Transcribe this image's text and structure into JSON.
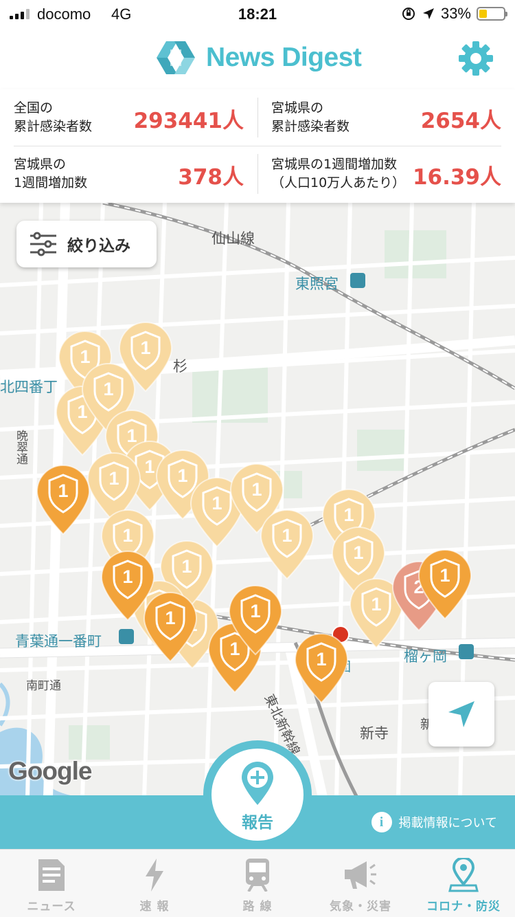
{
  "status_bar": {
    "carrier": "docomo",
    "network": "4G",
    "time": "18:21",
    "battery": "33%",
    "battery_level": 0.33
  },
  "header": {
    "title": "News Digest",
    "settings_icon": "gear-icon",
    "accent_color": "#4bbfcf"
  },
  "stats": [
    {
      "label": "全国の\n累計感染者数",
      "value": "293441人"
    },
    {
      "label": "宮城県の\n累計感染者数",
      "value": "2654人"
    },
    {
      "label": "宮城県の\n1週間増加数",
      "value": "378人"
    },
    {
      "label": "宮城県の1週間増加数\n（人口10万人あたり）",
      "value": "16.39人"
    }
  ],
  "stat_value_color": "#e5514b",
  "map": {
    "filter_label": "絞り込み",
    "attribution": "Google",
    "labels": {
      "senzan_line": "仙山線",
      "toshogu": "東照宮",
      "kitayobancho": "北四番丁",
      "sugi": "杉",
      "banshodori": "晩翠通",
      "aoba_ichibancho": "青葉通一番町",
      "tsutsujigaoka": "榴ヶ岡",
      "minamimachi": "南町通",
      "tohoku_shinkansen": "東北新幹線",
      "shinji": "新寺",
      "shin": "新",
      "de": "団"
    },
    "pins": [
      {
        "count": "1",
        "tone": "light"
      },
      {
        "count": "1",
        "tone": "light"
      },
      {
        "count": "1",
        "tone": "light"
      },
      {
        "count": "1",
        "tone": "light"
      },
      {
        "count": "1",
        "tone": "light"
      },
      {
        "count": "1",
        "tone": "light"
      },
      {
        "count": "1",
        "tone": "light"
      },
      {
        "count": "1",
        "tone": "light"
      },
      {
        "count": "1",
        "tone": "light"
      },
      {
        "count": "1",
        "tone": "light"
      },
      {
        "count": "1",
        "tone": "light"
      },
      {
        "count": "1",
        "tone": "light"
      },
      {
        "count": "1",
        "tone": "light"
      },
      {
        "count": "1",
        "tone": "light"
      },
      {
        "count": "1",
        "tone": "light"
      },
      {
        "count": "1",
        "tone": "light"
      },
      {
        "count": "1",
        "tone": "light"
      },
      {
        "count": "1",
        "tone": "light"
      },
      {
        "count": "2",
        "tone": "red"
      },
      {
        "count": "1",
        "tone": "orange"
      },
      {
        "count": "1",
        "tone": "orange"
      },
      {
        "count": "1",
        "tone": "orange"
      },
      {
        "count": "1",
        "tone": "orange"
      },
      {
        "count": "1",
        "tone": "orange"
      },
      {
        "count": "1",
        "tone": "orange"
      },
      {
        "count": "1",
        "tone": "orange"
      }
    ],
    "locate_icon": "location-arrow-icon"
  },
  "report": {
    "label": "報告",
    "info_label": "掲載情報について",
    "bar_color": "#5ec1d2"
  },
  "tabs": [
    {
      "label": "ニュース",
      "icon": "news-icon",
      "active": false
    },
    {
      "label": "速 報",
      "icon": "lightning-icon",
      "active": false
    },
    {
      "label": "路 線",
      "icon": "train-icon",
      "active": false
    },
    {
      "label": "気象・災害",
      "icon": "megaphone-icon",
      "active": false
    },
    {
      "label": "コロナ・防災",
      "icon": "map-pin-icon",
      "active": true
    }
  ]
}
